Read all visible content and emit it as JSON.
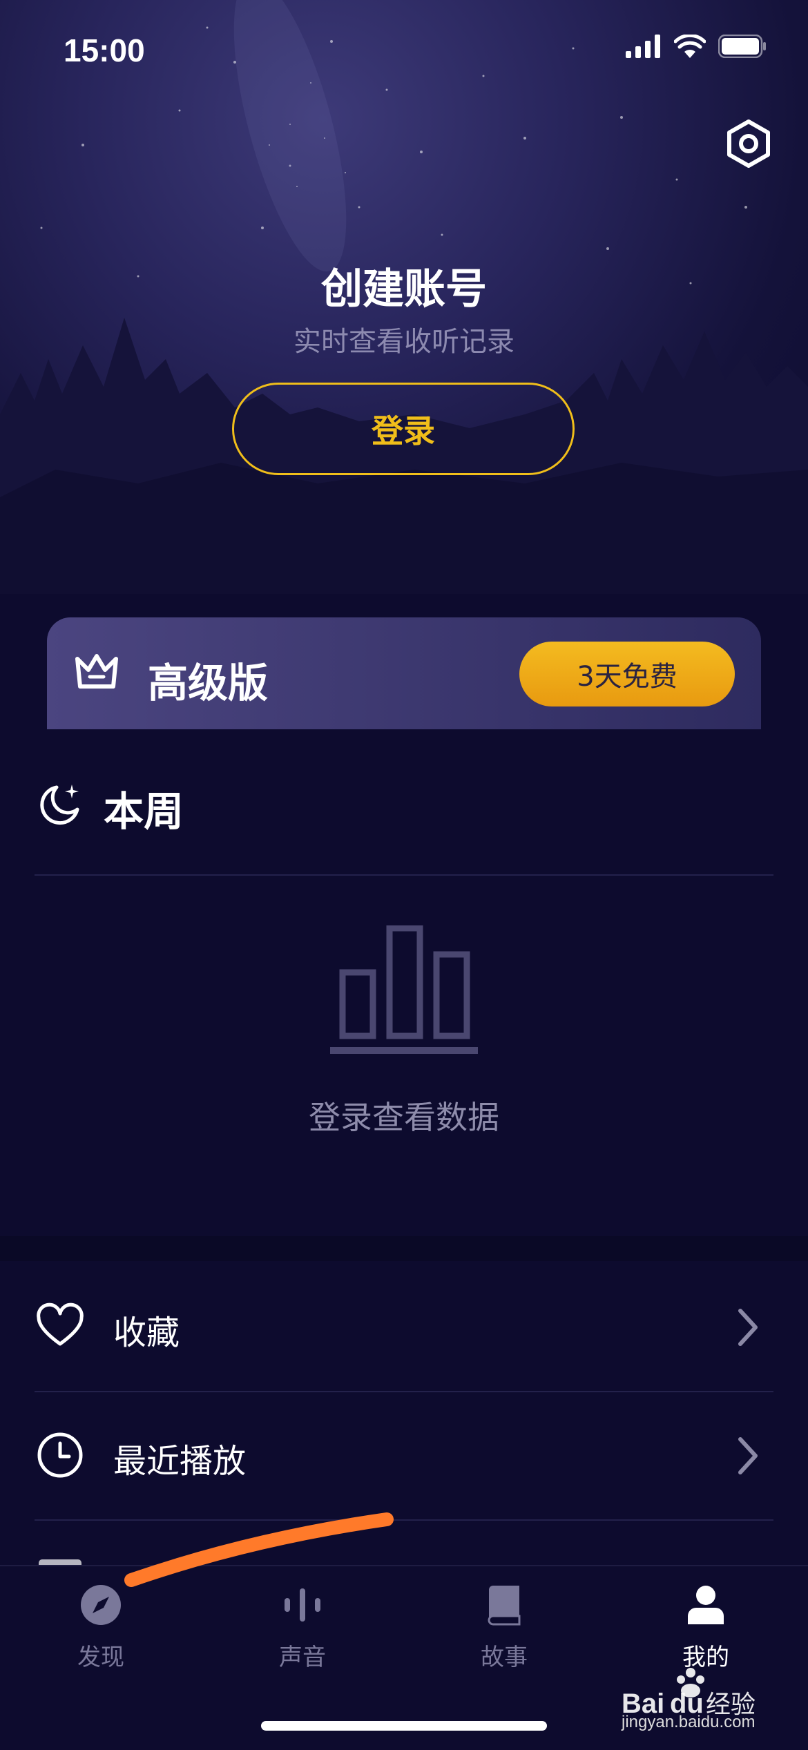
{
  "status_bar": {
    "time": "15:00"
  },
  "header": {
    "title": "创建账号",
    "subtitle": "实时查看收听记录",
    "login_label": "登录"
  },
  "premium": {
    "label": "高级版",
    "trial_label": "3天免费"
  },
  "week": {
    "title": "本周",
    "empty_text": "登录查看数据"
  },
  "list": {
    "items": [
      {
        "label": "收藏"
      },
      {
        "label": "最近播放"
      }
    ]
  },
  "tabs": [
    {
      "label": "发现"
    },
    {
      "label": "声音"
    },
    {
      "label": "故事"
    },
    {
      "label": "我的"
    }
  ],
  "colors": {
    "accent": "#f0be1a",
    "background": "#0d0b2e",
    "annotation": "#ff7a2a"
  },
  "watermark": {
    "url": "jingyan.baidu.com"
  }
}
